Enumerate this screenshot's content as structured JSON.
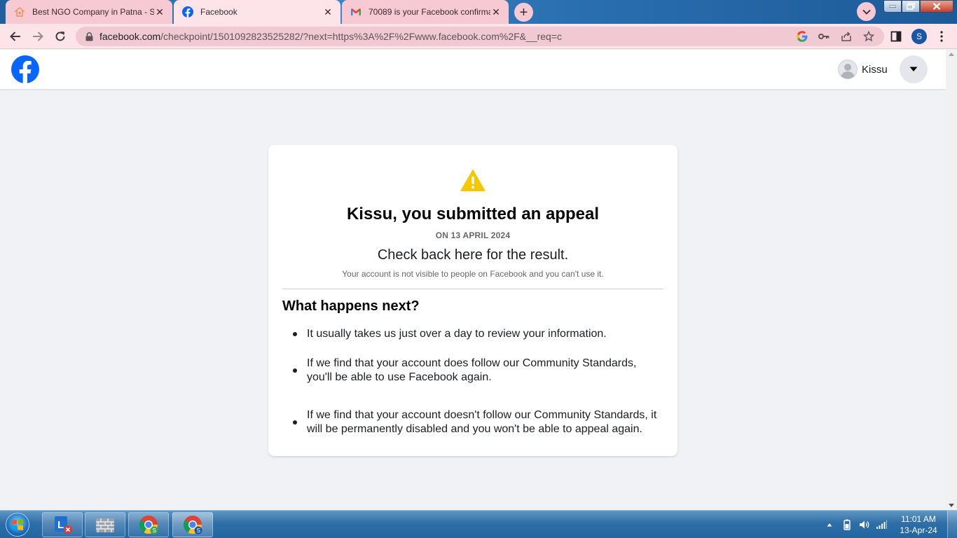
{
  "browser": {
    "tabs": [
      {
        "title": "Best NGO Company in Patna - Su",
        "icon": "ngo-favicon",
        "active": false
      },
      {
        "title": "Facebook",
        "icon": "facebook-favicon",
        "active": true
      },
      {
        "title": "70089 is your Facebook confirma",
        "icon": "gmail-favicon",
        "active": false
      }
    ],
    "new_tab": "+",
    "url_host": "facebook.com",
    "url_path": "/checkpoint/1501092823525282/?next=https%3A%2F%2Fwww.facebook.com%2F&__req=c",
    "profile_initial": "S"
  },
  "header": {
    "account_name": "Kissu"
  },
  "appeal": {
    "title": "Kissu, you submitted an appeal",
    "date": "ON 13 APRIL 2024",
    "subtitle": "Check back here for the result.",
    "note": "Your account is not visible to people on Facebook and you can't use it.",
    "next_heading": "What happens next?",
    "steps": [
      "It usually takes us just over a day to review your information.",
      "If we find that your account does follow our Community Standards, you'll be able to use Facebook again.",
      "If we find that your account doesn't follow our Community Standards, it will be permanently disabled and you won't be able to appeal again."
    ]
  },
  "taskbar": {
    "time": "11:01 AM",
    "date": "13-Apr-24"
  },
  "colors": {
    "facebook_blue": "#0866ff",
    "warning_yellow": "#f7c700",
    "tab_active": "#fde4e9",
    "tab_inactive": "#f6c9d3"
  }
}
